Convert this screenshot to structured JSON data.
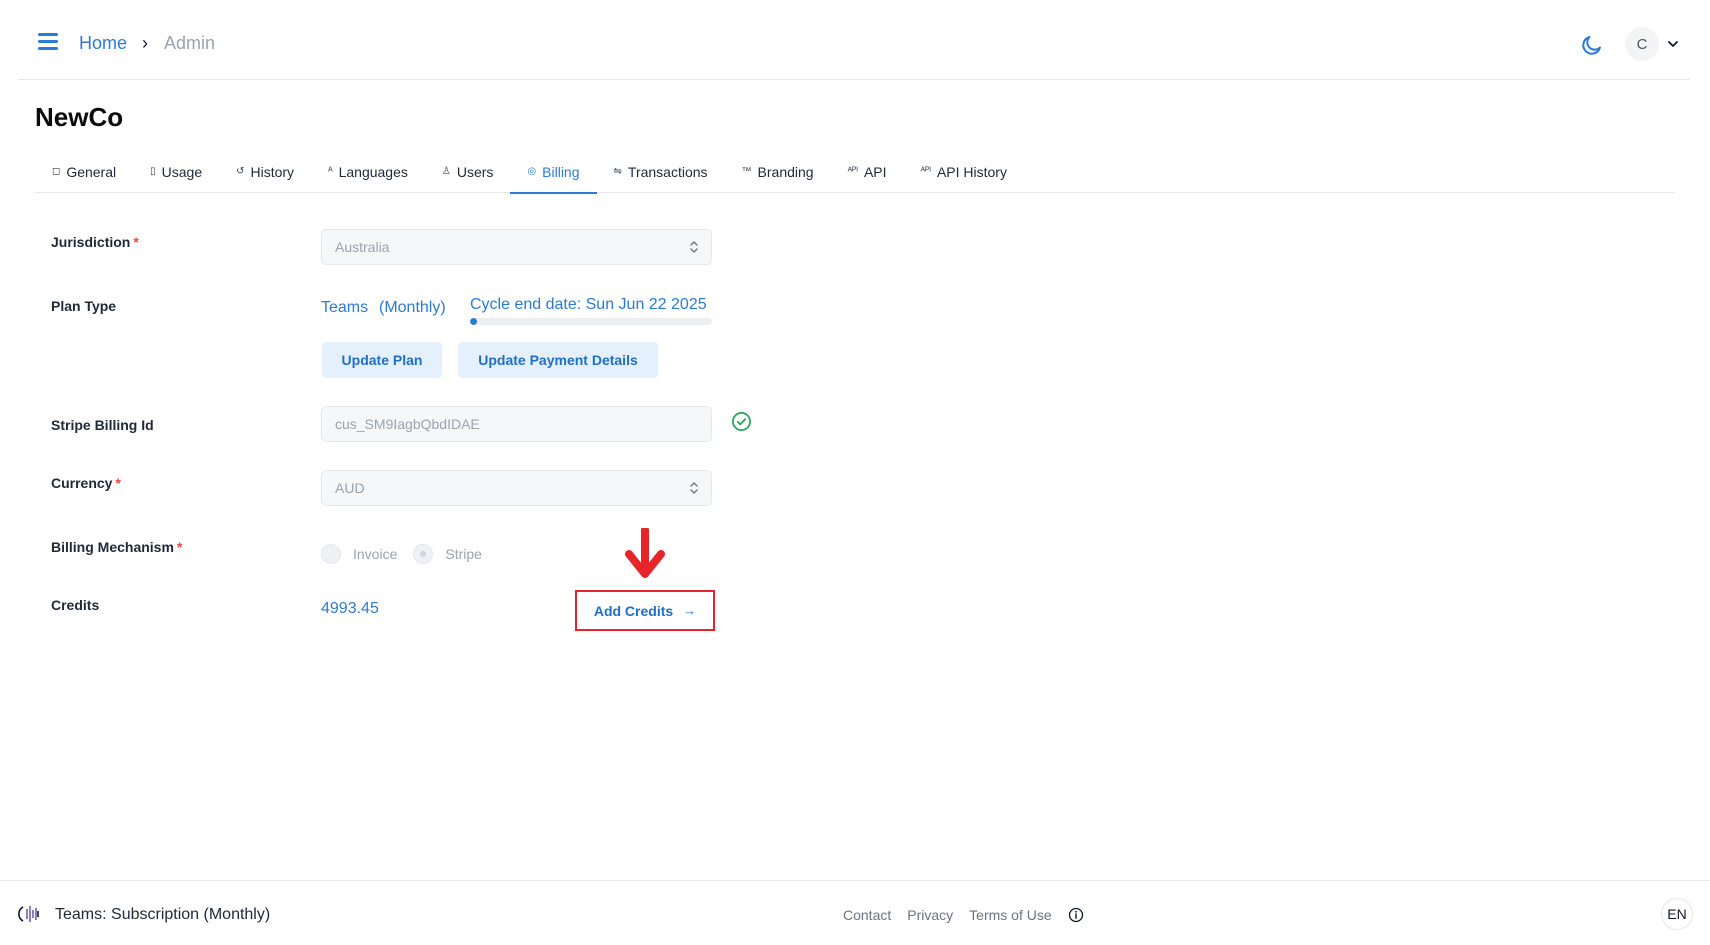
{
  "header": {
    "breadcrumb": {
      "home": "Home",
      "separator": "›",
      "current": "Admin"
    },
    "avatar_initial": "C",
    "accent_color": "#2b7bd6"
  },
  "page": {
    "title": "NewCo"
  },
  "tabs": [
    {
      "label": "General",
      "icon": "square-icon",
      "glyph": "◻"
    },
    {
      "label": "Usage",
      "icon": "database-icon",
      "glyph": "▯"
    },
    {
      "label": "History",
      "icon": "history-icon",
      "glyph": "↺"
    },
    {
      "label": "Languages",
      "icon": "translate-icon",
      "glyph": "ᴬ"
    },
    {
      "label": "Users",
      "icon": "user-icon",
      "glyph": "♙"
    },
    {
      "label": "Billing",
      "icon": "coins-icon",
      "glyph": "◎",
      "active": true
    },
    {
      "label": "Transactions",
      "icon": "transfer-icon",
      "glyph": "⇋"
    },
    {
      "label": "Branding",
      "icon": "trademark-icon",
      "glyph": "™"
    },
    {
      "label": "API",
      "icon": "api-icon",
      "glyph": "ᴬᴾᴵ"
    },
    {
      "label": "API History",
      "icon": "api-history-icon",
      "glyph": "ᴬᴾᴵ"
    }
  ],
  "form": {
    "jurisdiction": {
      "label": "Jurisdiction",
      "required": "*",
      "value": "Australia"
    },
    "plan_type": {
      "label": "Plan Type",
      "plan": "Teams",
      "period": "(Monthly)",
      "cycle_end": "Cycle end date: Sun Jun 22 2025",
      "cycle_progress_percent": 3,
      "update_plan_label": "Update Plan",
      "update_payment_label": "Update Payment Details"
    },
    "stripe_billing_id": {
      "label": "Stripe Billing Id",
      "value": "cus_SM9IagbQbdIDAE",
      "status": "verified"
    },
    "currency": {
      "label": "Currency",
      "required": "*",
      "value": "AUD"
    },
    "billing_mechanism": {
      "label": "Billing Mechanism",
      "required": "*",
      "options": [
        {
          "label": "Invoice",
          "checked": false
        },
        {
          "label": "Stripe",
          "checked": true
        }
      ]
    },
    "credits": {
      "label": "Credits",
      "value": "4993.45",
      "add_label": "Add Credits",
      "add_arrow": "→"
    }
  },
  "footer": {
    "plan_text": "Teams: Subscription (Monthly)",
    "links": {
      "contact": "Contact",
      "privacy": "Privacy",
      "terms": "Terms of Use"
    },
    "language": "EN"
  }
}
